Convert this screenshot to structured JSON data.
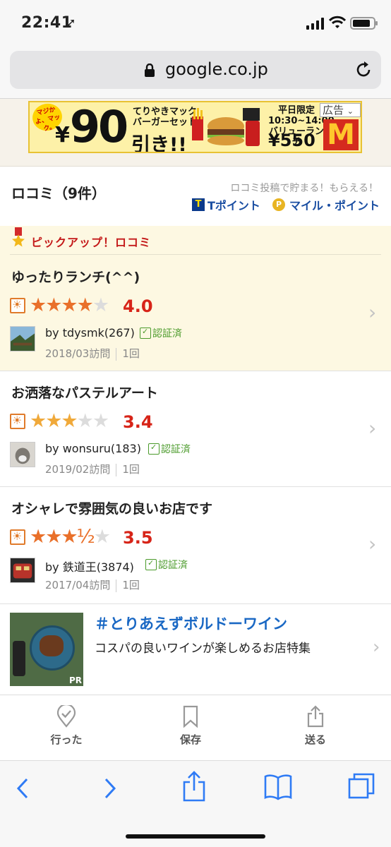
{
  "status_bar": {
    "time": "22:41"
  },
  "browser": {
    "url": "google.co.jp"
  },
  "ad": {
    "burst": "マジかよ、マック。",
    "price_big": "90",
    "yen": "¥",
    "product_line1": "てりやきマック",
    "product_line2": "バーガーセット",
    "discount_suffix": "引き!!",
    "limited": "平日限定",
    "hours": "10:30~14:00",
    "menu": "バリューランチ",
    "value_price": "¥550",
    "ad_label": "広告",
    "logo": "M"
  },
  "reviews": {
    "title": "ロコミ（9件）",
    "promo": "ロコミ投稿で貯まる！もらえる！",
    "tpoint_label": "Tポイント",
    "mile_label": "マイル・ポイント",
    "pickup_label": "ピックアップ！ロコミ",
    "items": [
      {
        "title": "ゆったりランチ(^^)",
        "stars_on": "★★★★",
        "stars_off": "★",
        "score": "4.0",
        "rating": 4.0,
        "user": "by tdysmk(267)",
        "certified": "認証済",
        "visit": "2018/03訪問",
        "count": "1回"
      },
      {
        "title": "お洒落なパステルアート",
        "stars_on": "★★★",
        "stars_off": "★★",
        "score": "3.4",
        "rating": 3.4,
        "user": "by wonsuru(183)",
        "certified": "認証済",
        "visit": "2019/02訪問",
        "count": "1回"
      },
      {
        "title": "オシャレで雰囲気の良いお店です",
        "stars_on": "★★★½",
        "stars_off": "★",
        "score": "3.5",
        "rating": 3.5,
        "user": "by 鉄道王(3874)",
        "certified": "認証済",
        "visit": "2017/04訪問",
        "count": "1回"
      }
    ]
  },
  "feature": {
    "title": "＃とりあえずボルドーワイン",
    "desc": "コスパの良いワインが楽しめるお店特集",
    "pr": "PR"
  },
  "actions": {
    "went": "行った",
    "save": "保存",
    "send": "送る"
  },
  "colors": {
    "accent_red": "#d72418",
    "star_orange": "#e9702a",
    "link_blue": "#1a68c4",
    "pickup_bg": "#fdf8e2"
  }
}
